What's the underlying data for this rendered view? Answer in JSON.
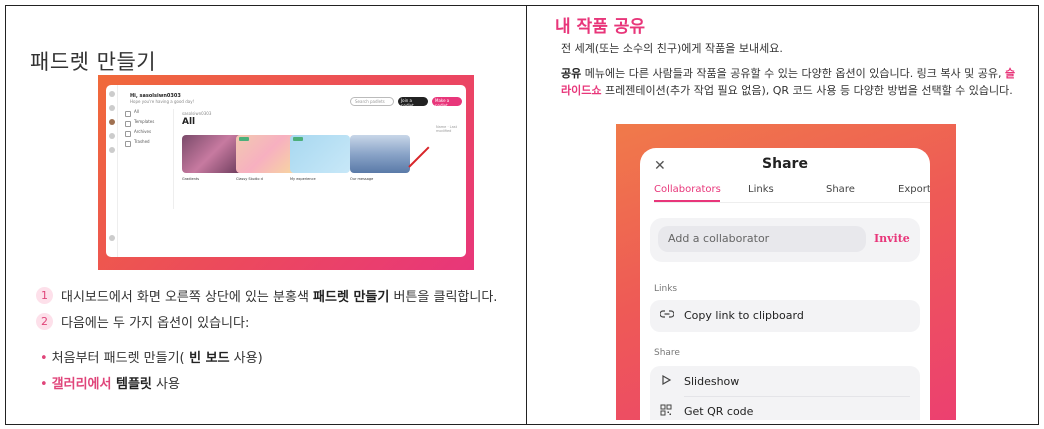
{
  "left": {
    "title": "패드렛 만들기",
    "screenshot": {
      "greeting": "Hi, sasolsiwn0303",
      "subgreeting": "Hope you're having a good day!",
      "search_placeholder": "Search padlets",
      "join_label": "Join a padlet",
      "make_label": "Make a padlet",
      "nav": [
        "All",
        "Templates",
        "Archives",
        "Trashed"
      ],
      "account": "sasolsiwn0303",
      "section": "All",
      "sort": "Name · Last modified",
      "captions": [
        "Gradients",
        "Classy Studio d",
        "My experience",
        "Our message"
      ]
    },
    "steps": [
      {
        "num": "1",
        "pre": "대시보드에서 화면 오른쪽 상단에 있는 분홍색 ",
        "bold": "패드렛 만들기",
        "post": " 버튼을 클릭합니다."
      },
      {
        "num": "2",
        "text": "다음에는 두 가지 옵션이 있습니다:"
      }
    ],
    "bullets": {
      "b1_pre": "처음부터 패드렛 만들기(",
      "b1_bold": " 빈 보드",
      "b1_post": " 사용)",
      "b2_pink": "갤러리에서",
      "b2_bold": " 템플릿",
      "b2_post": " 사용"
    }
  },
  "right": {
    "title": "내 작품 공유",
    "intro": "전 세계(또는 소수의 친구)에게 작품을 보내세요.",
    "para_bold": "공유",
    "para_1": " 메뉴에는 다른 사람들과 작품을 공유할 수 있는 다양한 옵션이 있습니다. 링크 복사 및 공유, ",
    "para_link": "슬라이드쇼",
    "para_2": " 프레젠테이션(추가 작업 필요 없음), QR 코드 사용 등 다양한 방법을 선택할 수 있습니다.",
    "modal": {
      "close": "✕",
      "title": "Share",
      "tabs": [
        "Collaborators",
        "Links",
        "Share",
        "Export"
      ],
      "collab_placeholder": "Add a collaborator",
      "invite": "Invite",
      "links_heading": "Links",
      "copy_link": "Copy link to clipboard",
      "share_heading": "Share",
      "slideshow": "Slideshow",
      "qr": "Get QR code"
    }
  },
  "colors": {
    "accent": "#e8367a",
    "step_bg": "#fde0ea"
  },
  "icons": {
    "link": "link-icon",
    "play": "play-icon",
    "qr": "qr-code-icon",
    "close": "close-icon"
  }
}
